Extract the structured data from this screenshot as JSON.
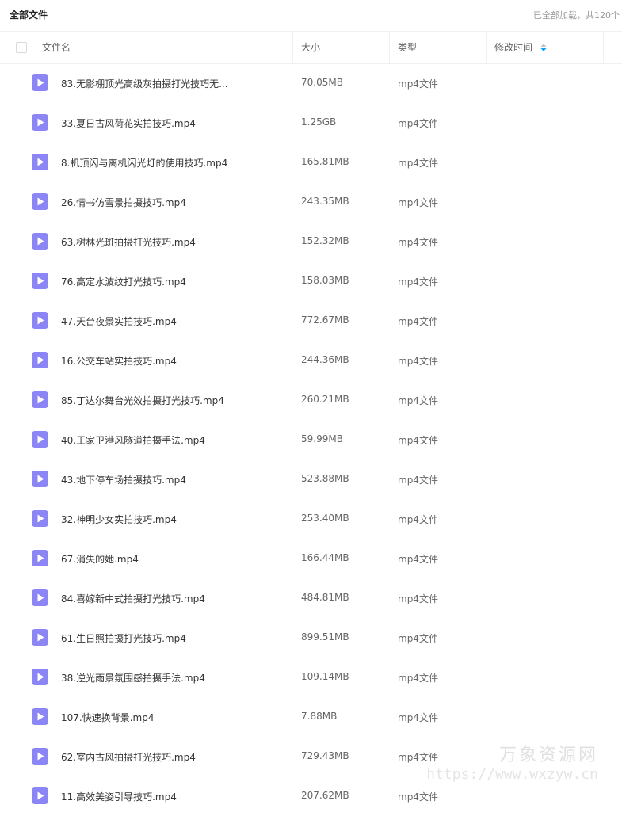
{
  "topbar": {
    "breadcrumb": "全部文件",
    "load_status": "已全部加载，共120个"
  },
  "table_header": {
    "name": "文件名",
    "size": "大小",
    "type": "类型",
    "modified": "修改时间"
  },
  "files": [
    {
      "name": "83.无影棚顶光高级灰拍摄打光技巧无...",
      "size": "70.05MB",
      "type": "mp4文件"
    },
    {
      "name": "33.夏日古风荷花实拍技巧.mp4",
      "size": "1.25GB",
      "type": "mp4文件"
    },
    {
      "name": "8.机顶闪与离机闪光灯的使用技巧.mp4",
      "size": "165.81MB",
      "type": "mp4文件"
    },
    {
      "name": "26.情书仿雪景拍摄技巧.mp4",
      "size": "243.35MB",
      "type": "mp4文件"
    },
    {
      "name": "63.树林光斑拍摄打光技巧.mp4",
      "size": "152.32MB",
      "type": "mp4文件"
    },
    {
      "name": "76.高定水波纹打光技巧.mp4",
      "size": "158.03MB",
      "type": "mp4文件"
    },
    {
      "name": "47.天台夜景实拍技巧.mp4",
      "size": "772.67MB",
      "type": "mp4文件"
    },
    {
      "name": "16.公交车站实拍技巧.mp4",
      "size": "244.36MB",
      "type": "mp4文件"
    },
    {
      "name": "85.丁达尔舞台光效拍摄打光技巧.mp4",
      "size": "260.21MB",
      "type": "mp4文件"
    },
    {
      "name": "40.王家卫港风隧道拍摄手法.mp4",
      "size": "59.99MB",
      "type": "mp4文件"
    },
    {
      "name": "43.地下停车场拍摄技巧.mp4",
      "size": "523.88MB",
      "type": "mp4文件"
    },
    {
      "name": "32.神明少女实拍技巧.mp4",
      "size": "253.40MB",
      "type": "mp4文件"
    },
    {
      "name": "67.消失的她.mp4",
      "size": "166.44MB",
      "type": "mp4文件"
    },
    {
      "name": "84.喜嫁新中式拍摄打光技巧.mp4",
      "size": "484.81MB",
      "type": "mp4文件"
    },
    {
      "name": "61.生日照拍摄打光技巧.mp4",
      "size": "899.51MB",
      "type": "mp4文件"
    },
    {
      "name": "38.逆光雨景氛围感拍摄手法.mp4",
      "size": "109.14MB",
      "type": "mp4文件"
    },
    {
      "name": "107.快速换背景.mp4",
      "size": "7.88MB",
      "type": "mp4文件"
    },
    {
      "name": "62.室内古风拍摄打光技巧.mp4",
      "size": "729.43MB",
      "type": "mp4文件"
    },
    {
      "name": "11.高效美姿引导技巧.mp4",
      "size": "207.62MB",
      "type": "mp4文件"
    }
  ],
  "watermark": {
    "text_cn": "万象资源网",
    "url": "https://www.wxzyw.cn"
  },
  "colors": {
    "video_icon": "#8c85f5",
    "sort_up": "#c0c4cc",
    "sort_down": "#06a7ff"
  },
  "icons": {
    "file": "video-file-icon",
    "sort": "sort-icon"
  }
}
